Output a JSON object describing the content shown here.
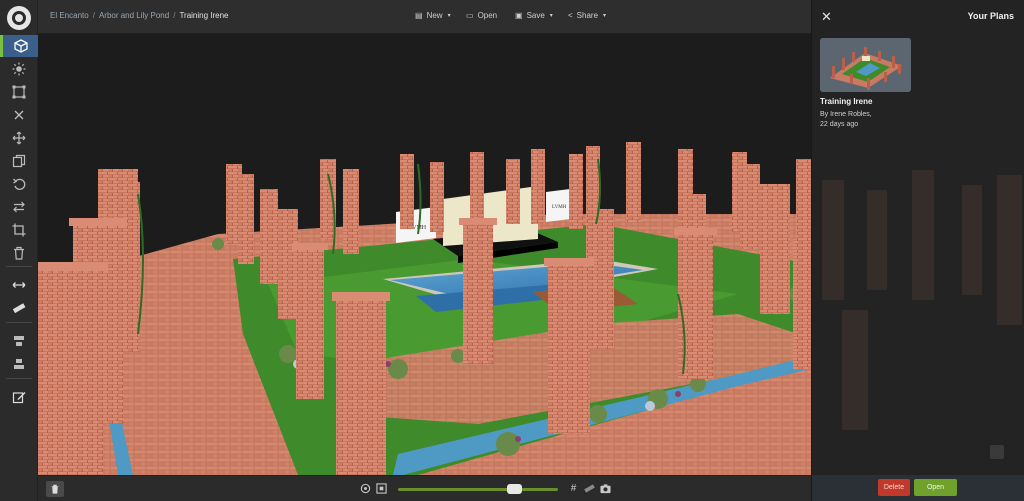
{
  "breadcrumb": {
    "items": [
      "El Encanto",
      "Arbor and Lily Pond"
    ],
    "current": "Training Irene"
  },
  "toolbar": {
    "new_label": "New",
    "open_label": "Open",
    "save_label": "Save",
    "share_label": "Share"
  },
  "left_tools": [
    "cube-icon",
    "sun-icon",
    "select-frame-icon",
    "close-icon",
    "move-icon",
    "copy-icon",
    "undo-icon",
    "swap-icon",
    "crop-icon",
    "trash-icon",
    "measure-icon",
    "ruler-icon",
    "align-top-icon",
    "align-bottom-icon",
    "edit-icon"
  ],
  "scene": {
    "sign_left": "LVMH",
    "sign_right": "LVMH"
  },
  "bottom": {
    "zoom_fraction": 0.73
  },
  "panel": {
    "title": "Your Plans",
    "plan_name": "Training Irene",
    "plan_author": "By Irene Robles,",
    "plan_time": "22 days ago",
    "delete_label": "Delete",
    "open_label": "Open"
  },
  "colors": {
    "accent_green": "#6ea22b",
    "delete_red": "#c0392b",
    "active_tool": "#3a5f8a"
  }
}
